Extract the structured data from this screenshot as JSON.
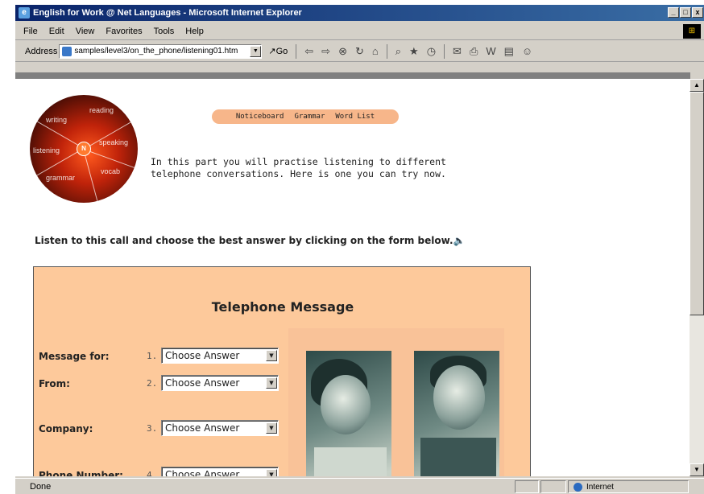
{
  "window": {
    "title": "English for Work @ Net Languages - Microsoft Internet Explorer",
    "controls": [
      "_",
      "□",
      "x"
    ]
  },
  "menu": [
    "File",
    "Edit",
    "View",
    "Favorites",
    "Tools",
    "Help"
  ],
  "address": {
    "label": "Address",
    "url": "samples/level3/on_the_phone/listening01.htm",
    "go_label": "Go"
  },
  "toolbar_icons": [
    "back-icon",
    "forward-icon",
    "stop-icon",
    "refresh-icon",
    "home-icon",
    "search-icon",
    "favorites-icon",
    "history-icon",
    "mail-icon",
    "print-icon",
    "edit-icon",
    "discuss-icon",
    "messenger-icon"
  ],
  "logo": {
    "words": [
      "writing",
      "reading",
      "listening",
      "speaking",
      "grammar",
      "vocab"
    ],
    "hub": "N"
  },
  "nav": [
    "Noticeboard",
    "Grammar",
    "Word List"
  ],
  "intro_text": "In this part you will practise listening to different telephone conversations. Here is one you can try now.",
  "instruction": "Listen to this call and choose the best answer by clicking on the form below.",
  "form": {
    "title": "Telephone Message",
    "fields": [
      {
        "label": "Message for:",
        "num": "1.",
        "value": "Choose Answer"
      },
      {
        "label": "From:",
        "num": "2.",
        "value": "Choose Answer"
      },
      {
        "label": "Company:",
        "num": "3.",
        "value": "Choose Answer"
      },
      {
        "label": "Phone Number:",
        "num": "4.",
        "value": "Choose Answer"
      }
    ]
  },
  "status": {
    "text": "Done",
    "zone": "Internet"
  }
}
